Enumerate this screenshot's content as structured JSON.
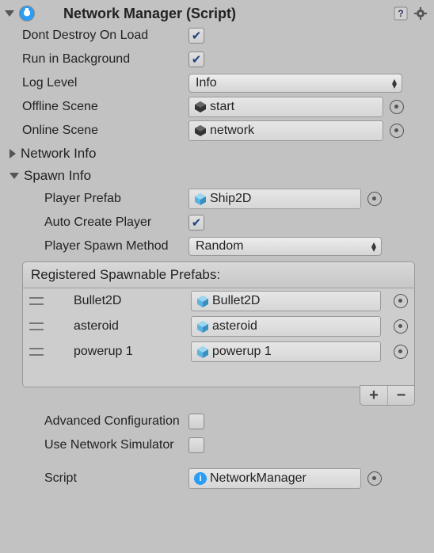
{
  "header": {
    "title": "Network Manager (Script)"
  },
  "fields": {
    "dontDestroy": {
      "label": "Dont Destroy On Load",
      "value": true
    },
    "runBg": {
      "label": "Run in Background",
      "value": true
    },
    "logLevel": {
      "label": "Log Level",
      "value": "Info"
    },
    "offline": {
      "label": "Offline Scene",
      "value": "start"
    },
    "online": {
      "label": "Online Scene",
      "value": "network"
    }
  },
  "sections": {
    "networkInfo": "Network Info",
    "spawnInfo": "Spawn Info"
  },
  "spawn": {
    "playerPrefab": {
      "label": "Player Prefab",
      "value": "Ship2D"
    },
    "autoCreate": {
      "label": "Auto Create Player",
      "value": true
    },
    "spawnMethod": {
      "label": "Player Spawn Method",
      "value": "Random"
    },
    "listHeader": "Registered Spawnable Prefabs:",
    "items": [
      {
        "name": "Bullet2D",
        "obj": "Bullet2D"
      },
      {
        "name": "asteroid",
        "obj": "asteroid"
      },
      {
        "name": "powerup 1",
        "obj": "powerup 1"
      }
    ]
  },
  "advanced": {
    "label": "Advanced Configuration",
    "value": false
  },
  "simulator": {
    "label": "Use Network Simulator",
    "value": false
  },
  "script": {
    "label": "Script",
    "value": "NetworkManager"
  }
}
